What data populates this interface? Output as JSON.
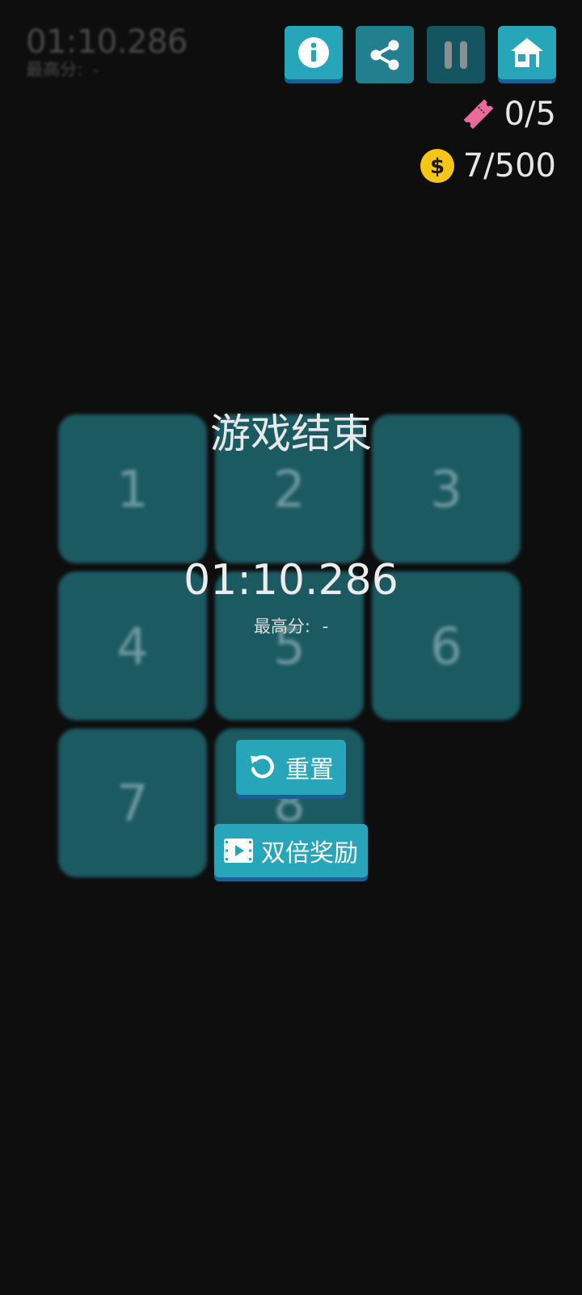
{
  "hud": {
    "time": "01:10.286",
    "best_label": "最高分:",
    "best_value": "-",
    "tickets": "0/5",
    "coins": "7/500"
  },
  "buttons": {
    "info_icon": "info-icon",
    "share_icon": "share-icon",
    "pause_icon": "pause-icon",
    "home_icon": "home-icon"
  },
  "board": {
    "tiles": [
      "1",
      "2",
      "3",
      "4",
      "5",
      "6",
      "7",
      "8"
    ]
  },
  "game_over": {
    "title": "游戏结束",
    "time": "01:10.286",
    "best_label": "最高分:",
    "best_value": "-",
    "reset_label": "重置",
    "double_reward_label": "双倍奖励"
  },
  "colors": {
    "background": "#0e0e0e",
    "button": "#27a6b9",
    "tile": "#1c5a62",
    "ticket": "#e96a9b",
    "coin": "#f5c518"
  }
}
